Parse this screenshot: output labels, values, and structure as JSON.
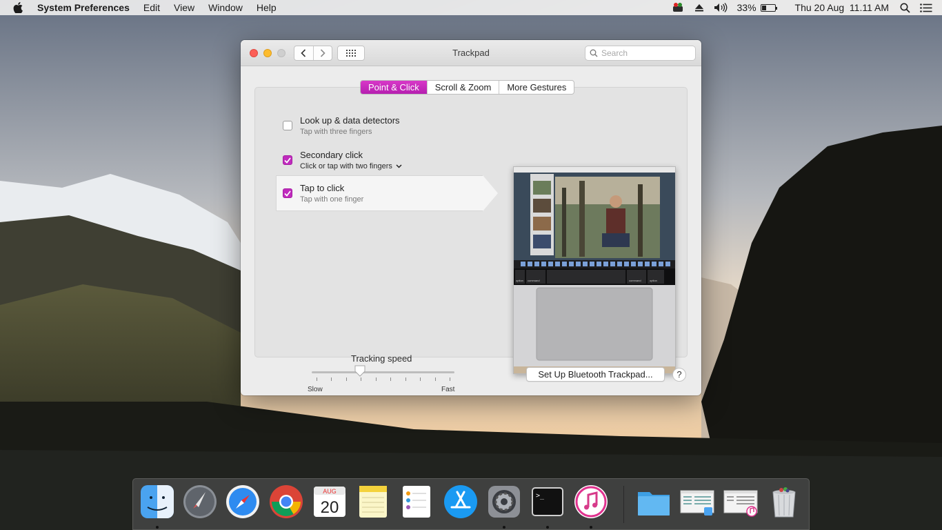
{
  "menubar": {
    "app_name": "System Preferences",
    "items": [
      "Edit",
      "View",
      "Window",
      "Help"
    ],
    "battery_percent": "33%",
    "battery_level": 0.33,
    "clock": "Thu 20 Aug  11.11 AM"
  },
  "window": {
    "title": "Trackpad",
    "search_placeholder": "Search",
    "tabs": [
      "Point & Click",
      "Scroll & Zoom",
      "More Gestures"
    ],
    "active_tab": 0,
    "options": [
      {
        "title": "Look up & data detectors",
        "subtitle": "Tap with three fingers",
        "checked": false
      },
      {
        "title": "Secondary click",
        "subtitle": "Click or tap with two fingers",
        "checked": true,
        "has_dropdown": true
      },
      {
        "title": "Tap to click",
        "subtitle": "Tap with one finger",
        "checked": true,
        "selected": true
      }
    ],
    "tracking": {
      "title": "Tracking speed",
      "min_label": "Slow",
      "max_label": "Fast",
      "value": 0.34,
      "tick_count": 10
    },
    "bluetooth_button": "Set Up Bluetooth Trackpad...",
    "help_button": "?",
    "preview_keys": [
      "option",
      "command",
      "command",
      "option"
    ]
  },
  "dock": {
    "calendar_month": "AUG",
    "calendar_day": "20",
    "icons": [
      "finder-icon",
      "launchpad-icon",
      "safari-icon",
      "chrome-icon",
      "calendar-icon",
      "notes-icon",
      "reminders-icon",
      "app-store-icon",
      "system-preferences-icon",
      "terminal-icon",
      "itunes-icon",
      "downloads-folder-icon",
      "finder-window-icon",
      "itunes-window-icon",
      "trash-icon"
    ]
  }
}
